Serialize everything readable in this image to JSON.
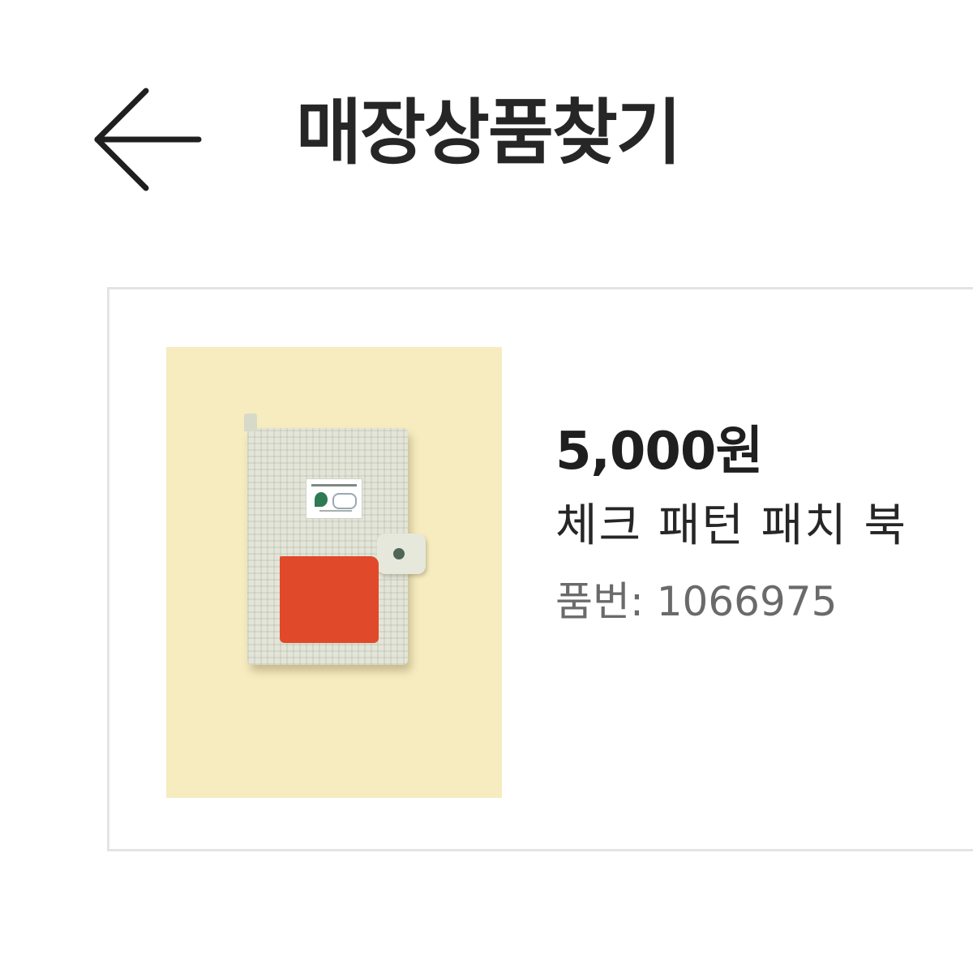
{
  "header": {
    "back_icon": "arrow-left-icon",
    "title": "매장상품찾기"
  },
  "product": {
    "price": "5,000원",
    "name": "체크 패턴 패치 북",
    "number_text": "품번: 1066975",
    "image_colors": {
      "background": "#f6ecc0",
      "notebook": "#e3e5d8",
      "pocket": "#e04a2a"
    }
  }
}
